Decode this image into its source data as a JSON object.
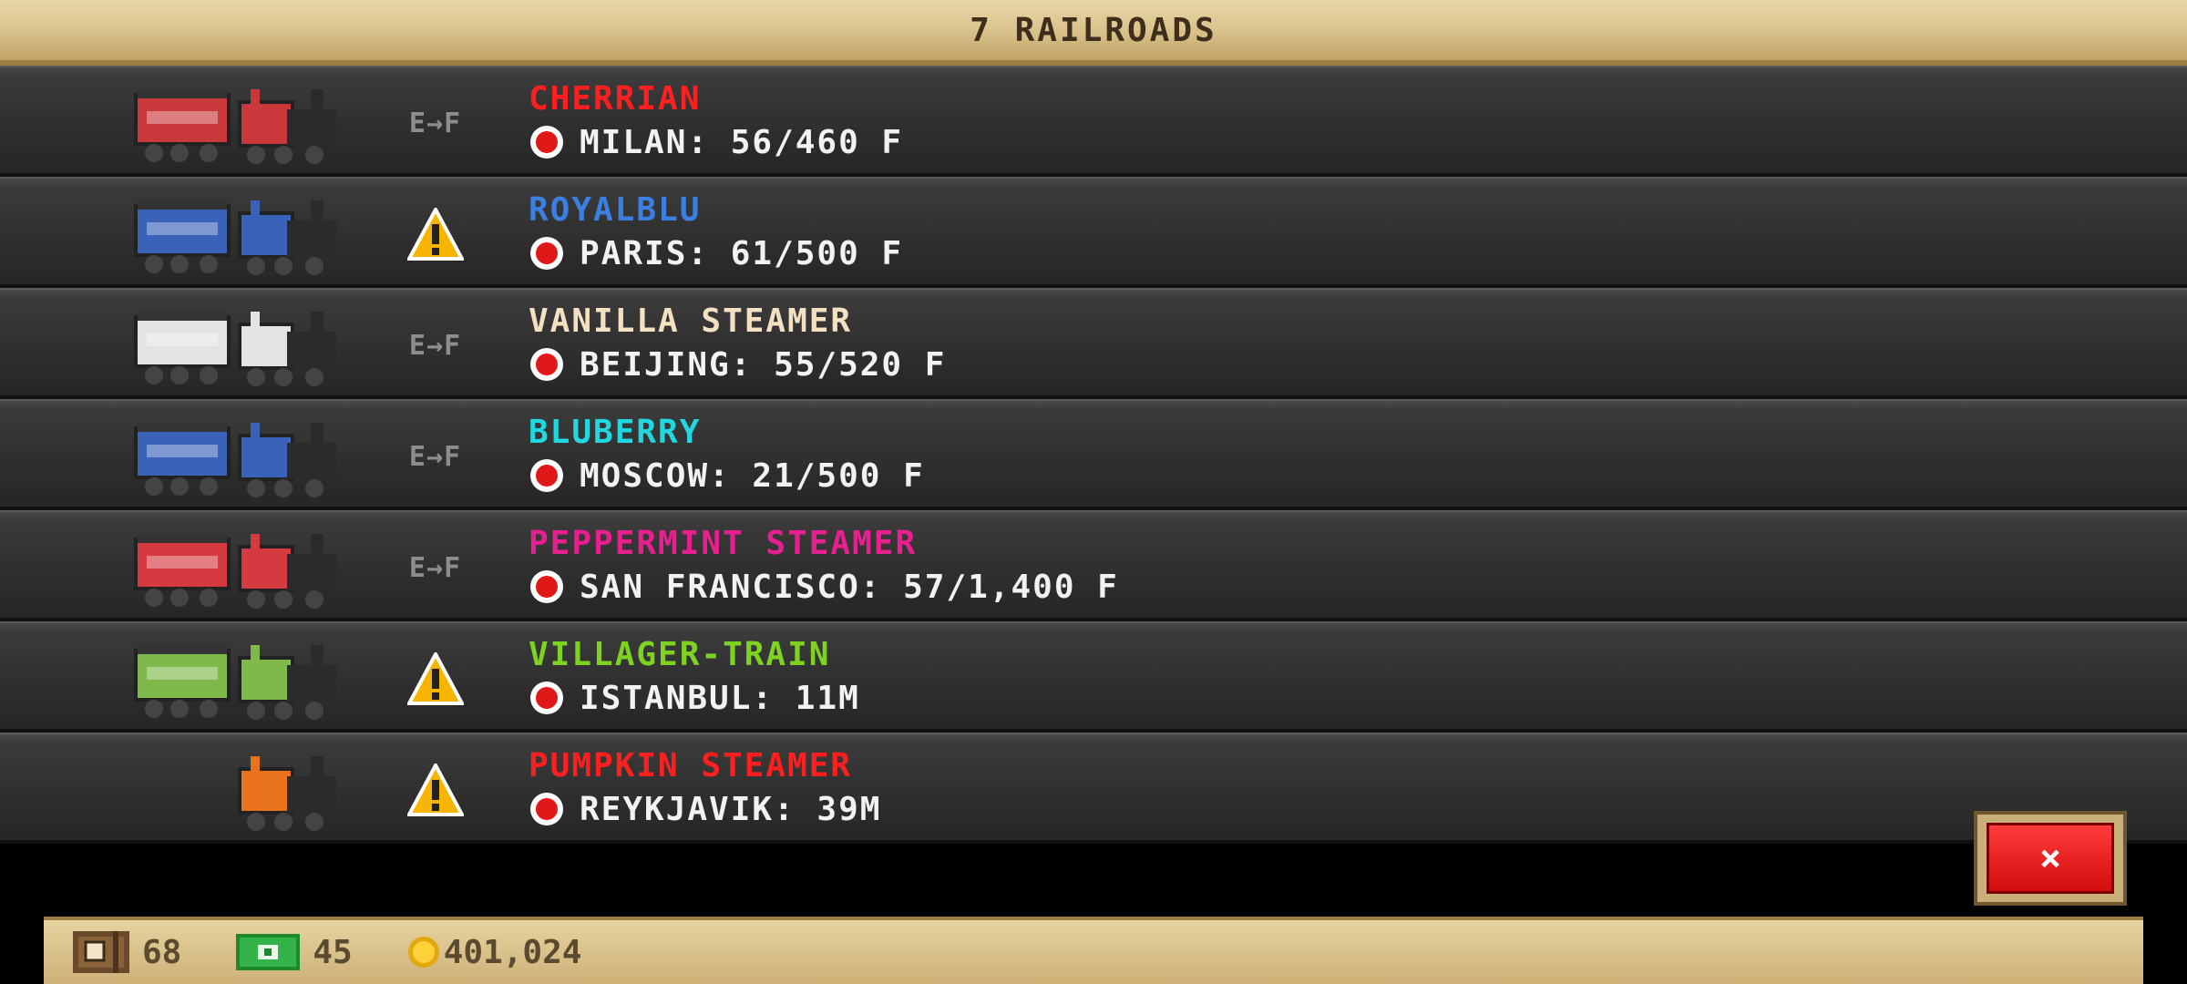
{
  "header": {
    "title": "7 RAILROADS"
  },
  "railroads": [
    {
      "name": "CHERRIAN",
      "name_color": "#ff1f1f",
      "destination": "MILAN: 56/460 F",
      "status": "E→F",
      "status_icon": "fuel-gauge-icon",
      "train_color": "#c9393b"
    },
    {
      "name": "ROYALBLU",
      "name_color": "#3b7fe0",
      "destination": "PARIS: 61/500 F",
      "status": "warning",
      "status_icon": "warning-icon",
      "train_color": "#3a62b8"
    },
    {
      "name": "VANILLA STEAMER",
      "name_color": "#f4e1c2",
      "destination": "BEIJING: 55/520 F",
      "status": "E→F",
      "status_icon": "fuel-gauge-icon",
      "train_color": "#e3e3e3"
    },
    {
      "name": "BLUBERRY",
      "name_color": "#22d8e0",
      "destination": "MOSCOW: 21/500 F",
      "status": "E→F",
      "status_icon": "fuel-gauge-icon",
      "train_color": "#3a62b8"
    },
    {
      "name": "PEPPERMINT STEAMER",
      "name_color": "#e8208f",
      "destination": "SAN FRANCISCO: 57/1,400 F",
      "status": "E→F",
      "status_icon": "fuel-gauge-icon",
      "train_color": "#d43a3f"
    },
    {
      "name": "VILLAGER-TRAIN",
      "name_color": "#7ed321",
      "destination": "ISTANBUL: 11M",
      "status": "warning",
      "status_icon": "warning-icon",
      "train_color": "#7fb84b"
    },
    {
      "name": "PUMPKIN STEAMER",
      "name_color": "#ff1f1f",
      "destination": "REYKJAVIK: 39M",
      "status": "warning",
      "status_icon": "warning-icon",
      "train_color": "#e8731c"
    }
  ],
  "close_button": {
    "label": "×"
  },
  "footer": {
    "resources": [
      {
        "icon": "crate-icon",
        "value": "68"
      },
      {
        "icon": "cash-icon",
        "value": "45"
      },
      {
        "icon": "coin-icon",
        "value": "401,024"
      }
    ]
  }
}
